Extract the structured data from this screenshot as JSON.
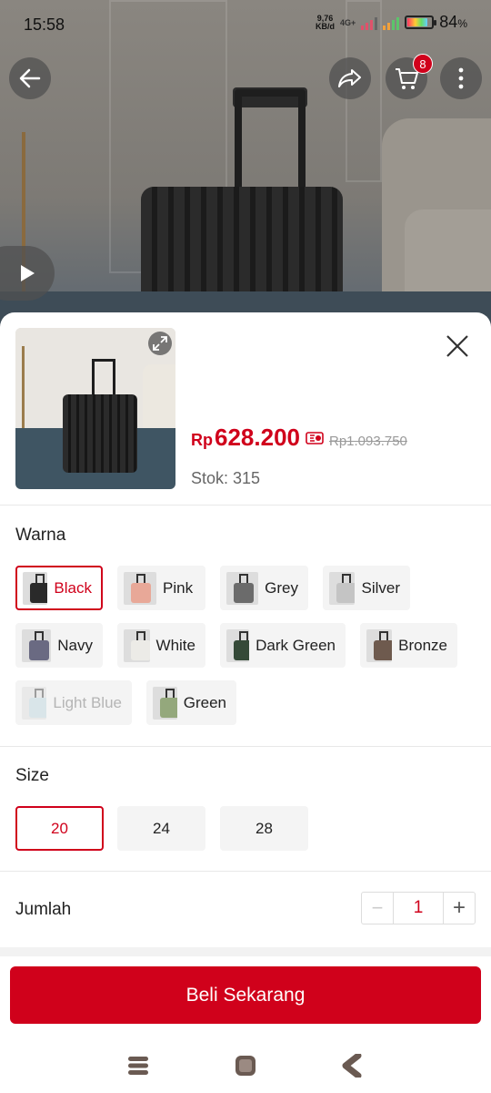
{
  "status_bar": {
    "time": "15:58",
    "net_speed_value": "9,76",
    "net_speed_unit": "KB/d",
    "network_type": "4G+",
    "battery_percent": "84",
    "battery_unit": "%",
    "battery_level": 0.84
  },
  "top_actions": {
    "cart_count": "8"
  },
  "product": {
    "price_currency": "Rp",
    "price": "628.200",
    "original_price": "Rp1.093.750",
    "stock_label": "Stok: 315"
  },
  "variants": {
    "color_title": "Warna",
    "colors": [
      {
        "label": "Black",
        "swatch": "#2a2a2a",
        "selected": true,
        "available": true
      },
      {
        "label": "Pink",
        "swatch": "#e8a898",
        "selected": false,
        "available": true
      },
      {
        "label": "Grey",
        "swatch": "#6b6b6b",
        "selected": false,
        "available": true
      },
      {
        "label": "Silver",
        "swatch": "#c4c4c4",
        "selected": false,
        "available": true
      },
      {
        "label": "Navy",
        "swatch": "#6a6a82",
        "selected": false,
        "available": true
      },
      {
        "label": "White",
        "swatch": "#ecebe7",
        "selected": false,
        "available": true
      },
      {
        "label": "Dark Green",
        "swatch": "#354a38",
        "selected": false,
        "available": true
      },
      {
        "label": "Bronze",
        "swatch": "#6e5a4e",
        "selected": false,
        "available": true
      },
      {
        "label": "Light Blue",
        "swatch": "#b9d3dc",
        "selected": false,
        "available": false
      },
      {
        "label": "Green",
        "swatch": "#94a87c",
        "selected": false,
        "available": true
      }
    ],
    "size_title": "Size",
    "sizes": [
      {
        "label": "20",
        "selected": true
      },
      {
        "label": "24",
        "selected": false
      },
      {
        "label": "28",
        "selected": false
      }
    ]
  },
  "quantity": {
    "title": "Jumlah",
    "value": "1",
    "minus_label": "−",
    "plus_label": "+"
  },
  "buy_button_label": "Beli Sekarang",
  "colors": {
    "accent": "#d0011b",
    "chip_bg": "#f4f4f4"
  }
}
